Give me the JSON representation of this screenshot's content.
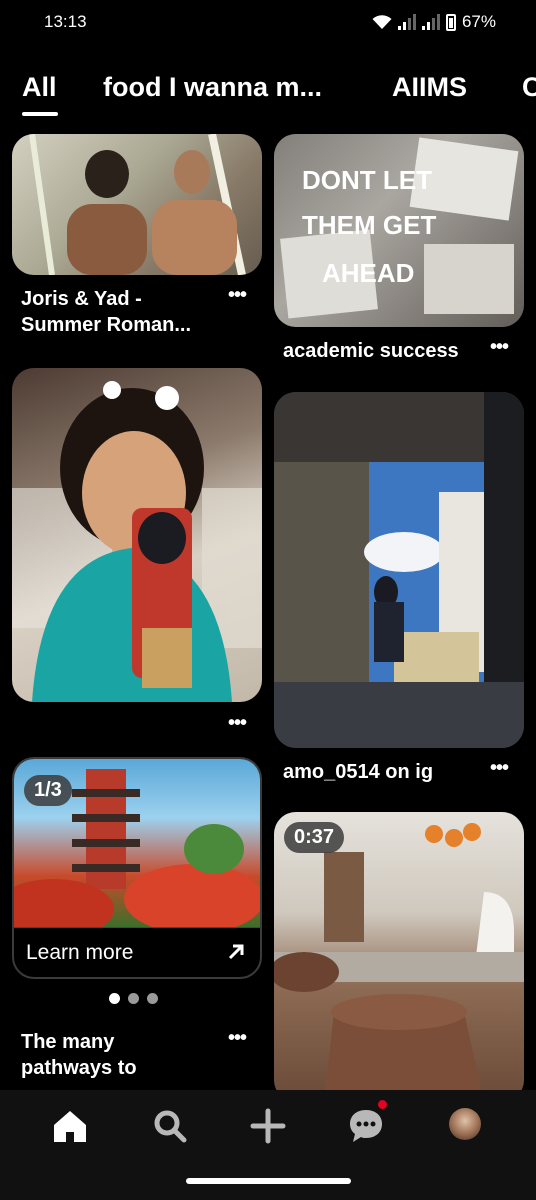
{
  "status": {
    "time": "13:13",
    "battery": "67%",
    "icons": [
      "wifi-icon",
      "signal-icon",
      "signal-icon",
      "battery-icon"
    ]
  },
  "tabs": [
    {
      "label": "All",
      "selected": true
    },
    {
      "label": "food I wanna m..."
    },
    {
      "label": "AIIMS"
    },
    {
      "label": "C"
    }
  ],
  "pins": {
    "joris": {
      "title_line1": "Joris & Yad -",
      "title_line2": "Summer Roman..."
    },
    "academic": {
      "title": "academic success",
      "image_text_1": "DONT LET",
      "image_text_2": "THEM GET",
      "image_text_3": "AHEAD"
    },
    "girl": {},
    "amo": {
      "title": "amo_0514 on ig"
    },
    "ad": {
      "counter": "1/3",
      "cta": "Learn more",
      "title_line1": "The many",
      "title_line2": "pathways to"
    },
    "video": {
      "duration": "0:37"
    }
  },
  "more_label": "•••",
  "nav": {
    "items": [
      "home-icon",
      "search-icon",
      "create-icon",
      "messages-icon",
      "profile-icon"
    ],
    "active": "home"
  },
  "colors": {
    "background": "#000000",
    "notification": "#e60023"
  }
}
